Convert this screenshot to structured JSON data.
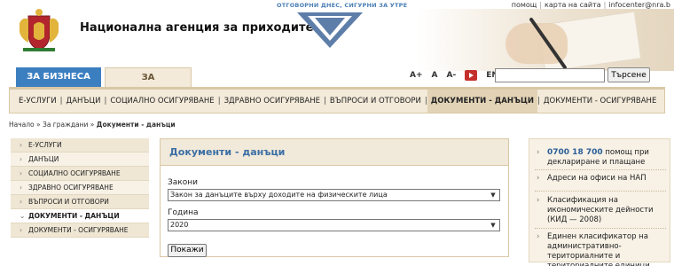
{
  "header": {
    "agency_name": "Национална агенция за приходите",
    "slogan": "ОТГОВОРНИ ДНЕС, СИГУРНИ ЗА УТРЕ",
    "top_links": [
      "помощ",
      "карта на сайта",
      "infocenter@nra.b"
    ]
  },
  "audience_tabs": {
    "business": "ЗА БИЗНЕСА",
    "citizens": "ЗА ГРАЖДАНИТЕ"
  },
  "tools": {
    "font_increase": "A+",
    "font_normal": "A",
    "font_decrease": "A-",
    "language": "EN",
    "search_value": "",
    "search_button": "Търсене"
  },
  "main_nav": [
    {
      "label": "Е-УСЛУГИ",
      "active": false
    },
    {
      "label": "ДАНЪЦИ",
      "active": false
    },
    {
      "label": "СОЦИАЛНО ОСИГУРЯВАНЕ",
      "active": false
    },
    {
      "label": "ЗДРАВНО ОСИГУРЯВАНЕ",
      "active": false
    },
    {
      "label": "ВЪПРОСИ И ОТГОВОРИ",
      "active": false
    },
    {
      "label": "ДОКУМЕНТИ - ДАНЪЦИ",
      "active": true
    },
    {
      "label": "ДОКУМЕНТИ - ОСИГУРЯВАНЕ",
      "active": false
    }
  ],
  "breadcrumb": {
    "home": "Начало",
    "section": "За граждани",
    "current": "Документи - данъци"
  },
  "sidebar": {
    "items": [
      {
        "label": "Е-УСЛУГИ",
        "active": false
      },
      {
        "label": "ДАНЪЦИ",
        "active": false
      },
      {
        "label": "СОЦИАЛНО ОСИГУРЯВАНЕ",
        "active": false
      },
      {
        "label": "ЗДРАВНО ОСИГУРЯВАНЕ",
        "active": false
      },
      {
        "label": "ВЪПРОСИ И ОТГОВОРИ",
        "active": false
      },
      {
        "label": "ДОКУМЕНТИ - ДАНЪЦИ",
        "active": true
      },
      {
        "label": "ДОКУМЕНТИ - ОСИГУРЯВАНЕ",
        "active": false
      }
    ]
  },
  "content": {
    "title": "Документи - данъци",
    "law_label": "Закони",
    "law_value": "Закон за данъците върху доходите на физическите лица",
    "year_label": "Година",
    "year_value": "2020",
    "show_button": "Покажи"
  },
  "right_links": {
    "phone": "0700 18 700",
    "phone_text": "помощ при деклариране и плащане",
    "offices": "Адреси на офиси на НАП",
    "kid": "Класификация на икономическите дейности (КИД — 2008)",
    "ekatte": "Единен класификатор на административно-териториалните и териториалните единици"
  }
}
